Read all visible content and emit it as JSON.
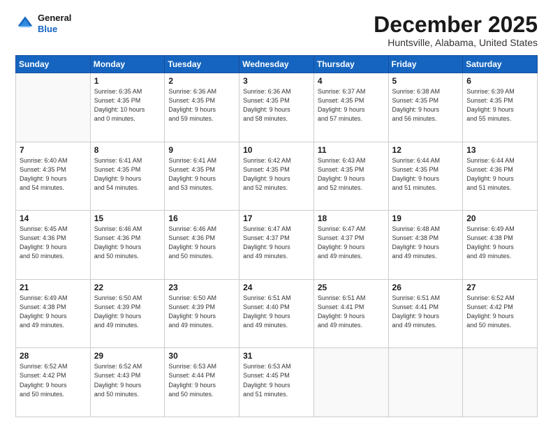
{
  "header": {
    "logo_line1": "General",
    "logo_line2": "Blue",
    "title": "December 2025",
    "subtitle": "Huntsville, Alabama, United States"
  },
  "days_of_week": [
    "Sunday",
    "Monday",
    "Tuesday",
    "Wednesday",
    "Thursday",
    "Friday",
    "Saturday"
  ],
  "weeks": [
    [
      {
        "day": "",
        "sunrise": "",
        "sunset": "",
        "daylight": ""
      },
      {
        "day": "1",
        "sunrise": "Sunrise: 6:35 AM",
        "sunset": "Sunset: 4:35 PM",
        "daylight": "Daylight: 10 hours and 0 minutes."
      },
      {
        "day": "2",
        "sunrise": "Sunrise: 6:36 AM",
        "sunset": "Sunset: 4:35 PM",
        "daylight": "Daylight: 9 hours and 59 minutes."
      },
      {
        "day": "3",
        "sunrise": "Sunrise: 6:36 AM",
        "sunset": "Sunset: 4:35 PM",
        "daylight": "Daylight: 9 hours and 58 minutes."
      },
      {
        "day": "4",
        "sunrise": "Sunrise: 6:37 AM",
        "sunset": "Sunset: 4:35 PM",
        "daylight": "Daylight: 9 hours and 57 minutes."
      },
      {
        "day": "5",
        "sunrise": "Sunrise: 6:38 AM",
        "sunset": "Sunset: 4:35 PM",
        "daylight": "Daylight: 9 hours and 56 minutes."
      },
      {
        "day": "6",
        "sunrise": "Sunrise: 6:39 AM",
        "sunset": "Sunset: 4:35 PM",
        "daylight": "Daylight: 9 hours and 55 minutes."
      }
    ],
    [
      {
        "day": "7",
        "sunrise": "Sunrise: 6:40 AM",
        "sunset": "Sunset: 4:35 PM",
        "daylight": "Daylight: 9 hours and 54 minutes."
      },
      {
        "day": "8",
        "sunrise": "Sunrise: 6:41 AM",
        "sunset": "Sunset: 4:35 PM",
        "daylight": "Daylight: 9 hours and 54 minutes."
      },
      {
        "day": "9",
        "sunrise": "Sunrise: 6:41 AM",
        "sunset": "Sunset: 4:35 PM",
        "daylight": "Daylight: 9 hours and 53 minutes."
      },
      {
        "day": "10",
        "sunrise": "Sunrise: 6:42 AM",
        "sunset": "Sunset: 4:35 PM",
        "daylight": "Daylight: 9 hours and 52 minutes."
      },
      {
        "day": "11",
        "sunrise": "Sunrise: 6:43 AM",
        "sunset": "Sunset: 4:35 PM",
        "daylight": "Daylight: 9 hours and 52 minutes."
      },
      {
        "day": "12",
        "sunrise": "Sunrise: 6:44 AM",
        "sunset": "Sunset: 4:35 PM",
        "daylight": "Daylight: 9 hours and 51 minutes."
      },
      {
        "day": "13",
        "sunrise": "Sunrise: 6:44 AM",
        "sunset": "Sunset: 4:36 PM",
        "daylight": "Daylight: 9 hours and 51 minutes."
      }
    ],
    [
      {
        "day": "14",
        "sunrise": "Sunrise: 6:45 AM",
        "sunset": "Sunset: 4:36 PM",
        "daylight": "Daylight: 9 hours and 50 minutes."
      },
      {
        "day": "15",
        "sunrise": "Sunrise: 6:46 AM",
        "sunset": "Sunset: 4:36 PM",
        "daylight": "Daylight: 9 hours and 50 minutes."
      },
      {
        "day": "16",
        "sunrise": "Sunrise: 6:46 AM",
        "sunset": "Sunset: 4:36 PM",
        "daylight": "Daylight: 9 hours and 50 minutes."
      },
      {
        "day": "17",
        "sunrise": "Sunrise: 6:47 AM",
        "sunset": "Sunset: 4:37 PM",
        "daylight": "Daylight: 9 hours and 49 minutes."
      },
      {
        "day": "18",
        "sunrise": "Sunrise: 6:47 AM",
        "sunset": "Sunset: 4:37 PM",
        "daylight": "Daylight: 9 hours and 49 minutes."
      },
      {
        "day": "19",
        "sunrise": "Sunrise: 6:48 AM",
        "sunset": "Sunset: 4:38 PM",
        "daylight": "Daylight: 9 hours and 49 minutes."
      },
      {
        "day": "20",
        "sunrise": "Sunrise: 6:49 AM",
        "sunset": "Sunset: 4:38 PM",
        "daylight": "Daylight: 9 hours and 49 minutes."
      }
    ],
    [
      {
        "day": "21",
        "sunrise": "Sunrise: 6:49 AM",
        "sunset": "Sunset: 4:38 PM",
        "daylight": "Daylight: 9 hours and 49 minutes."
      },
      {
        "day": "22",
        "sunrise": "Sunrise: 6:50 AM",
        "sunset": "Sunset: 4:39 PM",
        "daylight": "Daylight: 9 hours and 49 minutes."
      },
      {
        "day": "23",
        "sunrise": "Sunrise: 6:50 AM",
        "sunset": "Sunset: 4:39 PM",
        "daylight": "Daylight: 9 hours and 49 minutes."
      },
      {
        "day": "24",
        "sunrise": "Sunrise: 6:51 AM",
        "sunset": "Sunset: 4:40 PM",
        "daylight": "Daylight: 9 hours and 49 minutes."
      },
      {
        "day": "25",
        "sunrise": "Sunrise: 6:51 AM",
        "sunset": "Sunset: 4:41 PM",
        "daylight": "Daylight: 9 hours and 49 minutes."
      },
      {
        "day": "26",
        "sunrise": "Sunrise: 6:51 AM",
        "sunset": "Sunset: 4:41 PM",
        "daylight": "Daylight: 9 hours and 49 minutes."
      },
      {
        "day": "27",
        "sunrise": "Sunrise: 6:52 AM",
        "sunset": "Sunset: 4:42 PM",
        "daylight": "Daylight: 9 hours and 50 minutes."
      }
    ],
    [
      {
        "day": "28",
        "sunrise": "Sunrise: 6:52 AM",
        "sunset": "Sunset: 4:42 PM",
        "daylight": "Daylight: 9 hours and 50 minutes."
      },
      {
        "day": "29",
        "sunrise": "Sunrise: 6:52 AM",
        "sunset": "Sunset: 4:43 PM",
        "daylight": "Daylight: 9 hours and 50 minutes."
      },
      {
        "day": "30",
        "sunrise": "Sunrise: 6:53 AM",
        "sunset": "Sunset: 4:44 PM",
        "daylight": "Daylight: 9 hours and 50 minutes."
      },
      {
        "day": "31",
        "sunrise": "Sunrise: 6:53 AM",
        "sunset": "Sunset: 4:45 PM",
        "daylight": "Daylight: 9 hours and 51 minutes."
      },
      {
        "day": "",
        "sunrise": "",
        "sunset": "",
        "daylight": ""
      },
      {
        "day": "",
        "sunrise": "",
        "sunset": "",
        "daylight": ""
      },
      {
        "day": "",
        "sunrise": "",
        "sunset": "",
        "daylight": ""
      }
    ]
  ]
}
